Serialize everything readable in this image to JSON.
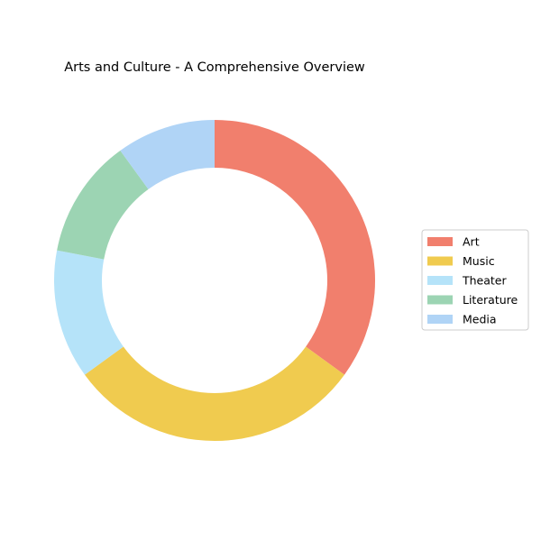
{
  "chart_data": {
    "type": "pie",
    "subtype": "donut",
    "title": "Arts and Culture - A Comprehensive Overview",
    "categories": [
      "Art",
      "Music",
      "Theater",
      "Literature",
      "Media"
    ],
    "values": [
      35,
      30,
      13,
      12,
      10
    ],
    "colors": [
      "#f17f6d",
      "#f0cb4f",
      "#b5e3f9",
      "#9cd4b3",
      "#b0d4f6"
    ],
    "legend": "right",
    "start_angle": "top, clockwise"
  }
}
